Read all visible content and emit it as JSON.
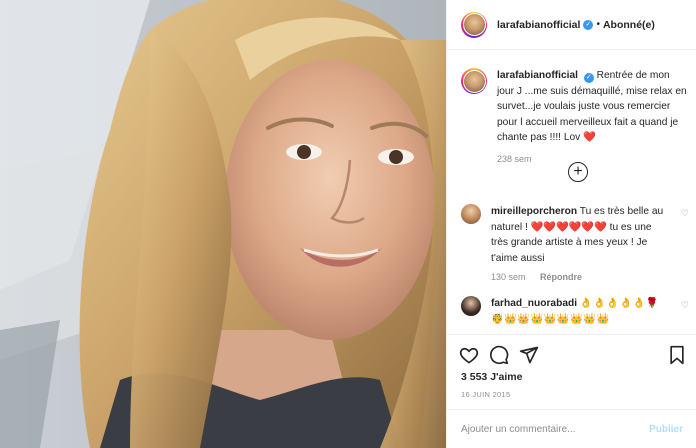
{
  "post": {
    "username": "larafabianofficial",
    "separator": "•",
    "follow_status": "Abonné(e)",
    "verified_mark": "✓"
  },
  "caption": {
    "username": "larafabianofficial",
    "text": "Rentrée de mon jour J ...me suis démaquillé, mise relax en survet...je voulais juste vous remercier pour l accueil merveilleux fait a quand je chante pas !!!! Lov",
    "heart": "❤️",
    "time": "238 sem"
  },
  "load_more_icon": "plus-circle-icon",
  "comments": [
    {
      "username": "mireilleporcheron",
      "text_before": "Tu es très belle au naturel !",
      "hearts": "❤️❤️❤️❤️❤️❤️",
      "text_after": "tu es une très grande artiste à mes yeux ! Je t'aime aussi",
      "time": "130 sem",
      "reply_label": "Répondre"
    },
    {
      "username": "farhad_nuorabadi",
      "text": "👌👌👌👌👌🌹🤴👑👑👑👑👑👑👑👑"
    }
  ],
  "likes": "3 553 J'aime",
  "date": "16 JUIN 2015",
  "add_comment": {
    "placeholder": "Ajouter un commentaire...",
    "publish_label": "Publier"
  },
  "colors": {
    "verified_blue": "#3897f0",
    "muted_text": "#8e8e8e",
    "publish_disabled": "#b2dffc"
  }
}
